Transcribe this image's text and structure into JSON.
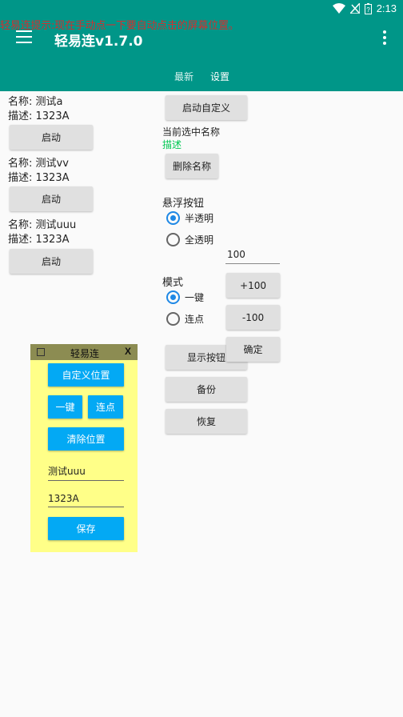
{
  "statusbar": {
    "time": "2:13"
  },
  "toast": "轻易连提示:现在手动点一下要自动点击的屏幕位置。",
  "appbar": {
    "title": "轻易连v1.7.0",
    "tabs": [
      "最新",
      "设置"
    ]
  },
  "left_list": [
    {
      "name": "名称: 测试a",
      "desc": "描述: 1323A",
      "button": "启动"
    },
    {
      "name": "名称: 测试vv",
      "desc": "描述: 1323A",
      "button": "启动"
    },
    {
      "name": "名称: 测试uuu",
      "desc": "描述: 1323A",
      "button": "启动"
    }
  ],
  "right": {
    "start_custom": "启动自定义",
    "current_name_label": "当前选中名称",
    "current_desc": "描述",
    "delete_name": "删除名称",
    "float_button_label": "悬浮按钮",
    "float_options": [
      "半透明",
      "全透明"
    ],
    "float_selected": "半透明",
    "number_value": "100",
    "plus_100": "+100",
    "minus_100": "-100",
    "confirm": "确定",
    "mode_label": "模式",
    "mode_options": [
      "一键",
      "连点"
    ],
    "mode_selected": "一键",
    "show_button": "显示按钮",
    "backup": "备份",
    "restore": "恢复"
  },
  "floating_panel": {
    "title": "轻易连",
    "close": "X",
    "custom_position": "自定义位置",
    "one_key": "一键",
    "multi_click": "连点",
    "clear_position": "清除位置",
    "name_value": "测试uuu",
    "desc_value": "1323A",
    "save": "保存"
  },
  "colors": {
    "appbar": "#009688",
    "accent_blue": "#1e88e5",
    "panel_bg": "#ffff88",
    "panel_button": "#03a9f4",
    "toast": "#d32f2f",
    "desc_green": "#00c853"
  }
}
